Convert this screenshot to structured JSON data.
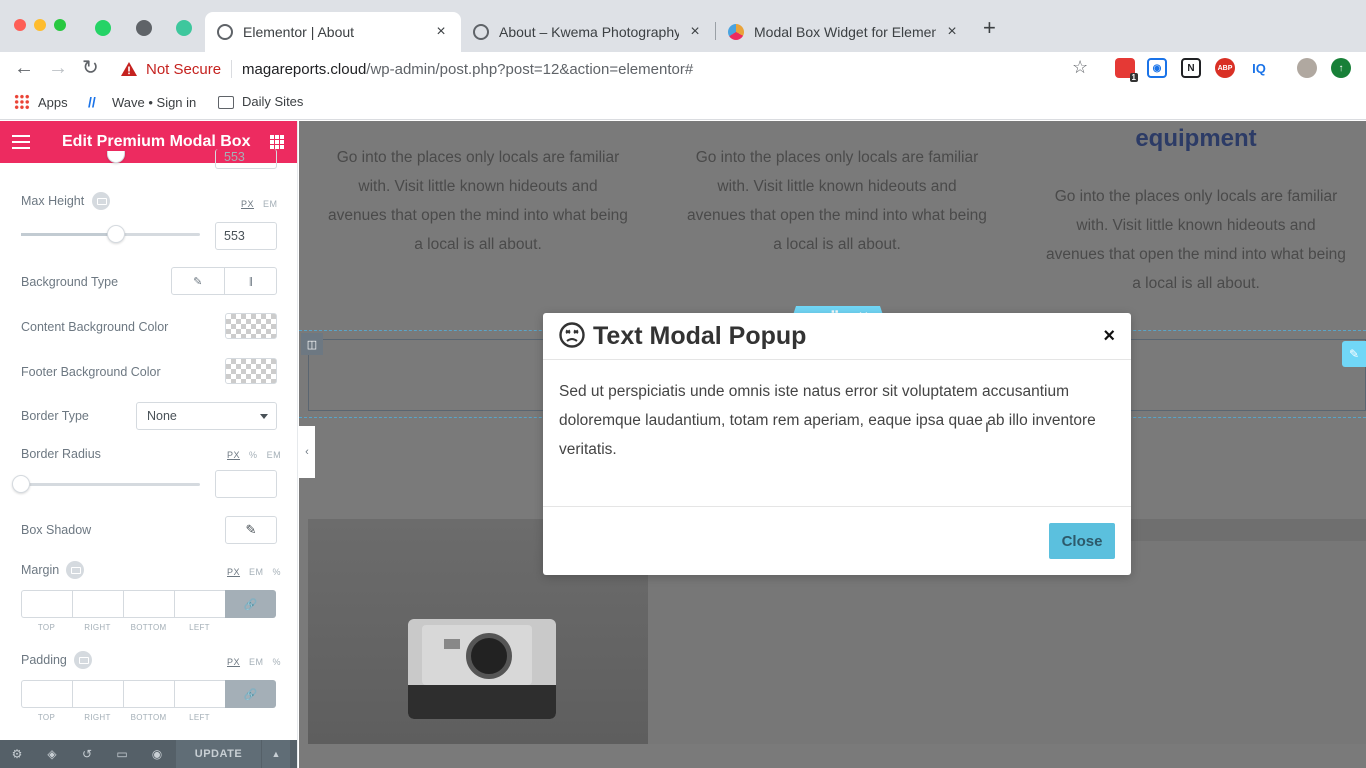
{
  "browser": {
    "tabs": [
      {
        "title": "Elementor | About",
        "favicon_color": "#5f6368"
      },
      {
        "title": "About – Kwema Photography",
        "favicon_color": "#5f6368"
      },
      {
        "title": "Modal Box Widget for Elementor",
        "favicon_color": "#e9a33a"
      }
    ],
    "security_label": "Not Secure",
    "url_host": "magareports.cloud",
    "url_path": "/wp-admin/post.php?post=12&action=elementor#",
    "bookmarks": [
      "Apps",
      "Wave • Sign in",
      "Daily Sites"
    ],
    "extension_badge": "1"
  },
  "panel": {
    "title": "Edit Premium Modal Box",
    "partial_value": "553",
    "max_height": {
      "label": "Max Height",
      "units": [
        "PX",
        "EM"
      ],
      "value": "553",
      "slider_fraction": 0.53
    },
    "background_type": {
      "label": "Background Type"
    },
    "content_bg": {
      "label": "Content Background Color"
    },
    "footer_bg": {
      "label": "Footer Background Color"
    },
    "border_type": {
      "label": "Border Type",
      "value": "None"
    },
    "border_radius": {
      "label": "Border Radius",
      "units": [
        "PX",
        "%",
        "EM"
      ],
      "value": "",
      "slider_fraction": 0.0
    },
    "box_shadow": {
      "label": "Box Shadow"
    },
    "margin": {
      "label": "Margin",
      "units": [
        "PX",
        "EM",
        "%"
      ],
      "sides": [
        "TOP",
        "RIGHT",
        "BOTTOM",
        "LEFT"
      ]
    },
    "padding": {
      "label": "Padding",
      "units": [
        "PX",
        "EM",
        "%"
      ],
      "sides": [
        "TOP",
        "RIGHT",
        "BOTTOM",
        "LEFT"
      ]
    },
    "update_label": "UPDATE"
  },
  "canvas": {
    "column_text": "Go into the places only locals are familiar with. Visit little known hideouts and avenues that open the mind into what being a local is all about.",
    "col3_heading": "equipment"
  },
  "modal": {
    "title": "Text Modal Popup",
    "body": "Sed ut perspiciatis unde omnis iste natus error sit voluptatem accusantium doloremque laudantium, totam rem aperiam, eaque ipsa quae ab illo inventore veritatis.",
    "close_label": "Close",
    "close_symbol": "×"
  },
  "colors": {
    "elementor_pink": "#ed2b60",
    "modal_close_bg": "#5bc0de",
    "widget_handle": "#71d7f7"
  }
}
